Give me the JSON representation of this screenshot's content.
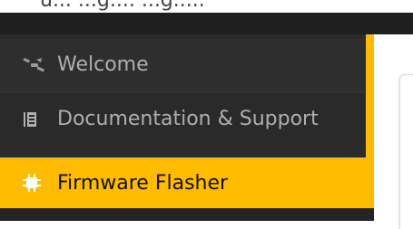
{
  "top_partial_text": "u... ...g.... ...g.....",
  "nav": {
    "items": [
      {
        "label": "Welcome",
        "icon": "satellite-icon",
        "active": false
      },
      {
        "label": "Documentation & Support",
        "icon": "book-icon",
        "active": false
      },
      {
        "label": "Firmware Flasher",
        "icon": "chip-icon",
        "active": true
      }
    ]
  },
  "colors": {
    "accent": "#ffbb00",
    "sidebar_bg": "#2b2b2b",
    "topbar_bg": "#1f1f1f",
    "nav_text": "#aeaeae",
    "active_text": "#111111"
  }
}
